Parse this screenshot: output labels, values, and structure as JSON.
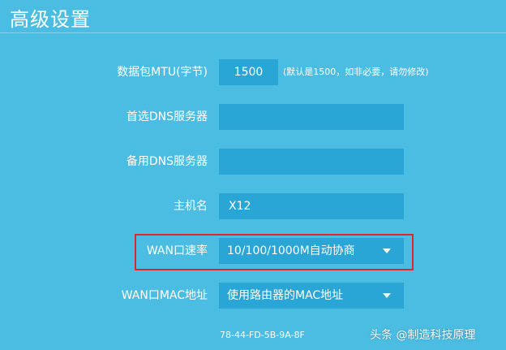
{
  "page": {
    "title": "高级设置"
  },
  "form": {
    "mtu": {
      "label": "数据包MTU(字节)",
      "value": "1500",
      "hint": "(默认是1500，如非必要，请勿修改)"
    },
    "primary_dns": {
      "label": "首选DNS服务器",
      "value": ""
    },
    "secondary_dns": {
      "label": "备用DNS服务器",
      "value": ""
    },
    "hostname": {
      "label": "主机名",
      "value": "X12"
    },
    "wan_speed": {
      "label": "WAN口速率",
      "selected": "10/100/1000M自动协商"
    },
    "wan_mac": {
      "label": "WAN口MAC地址",
      "selected": "使用路由器的MAC地址",
      "address": "78-44-FD-5B-9A-8F"
    }
  },
  "watermark": {
    "text": "头条 @制造科技原理"
  },
  "colors": {
    "background": "#4bbde3",
    "field": "#2aa6d6",
    "highlight": "#e0252b"
  }
}
